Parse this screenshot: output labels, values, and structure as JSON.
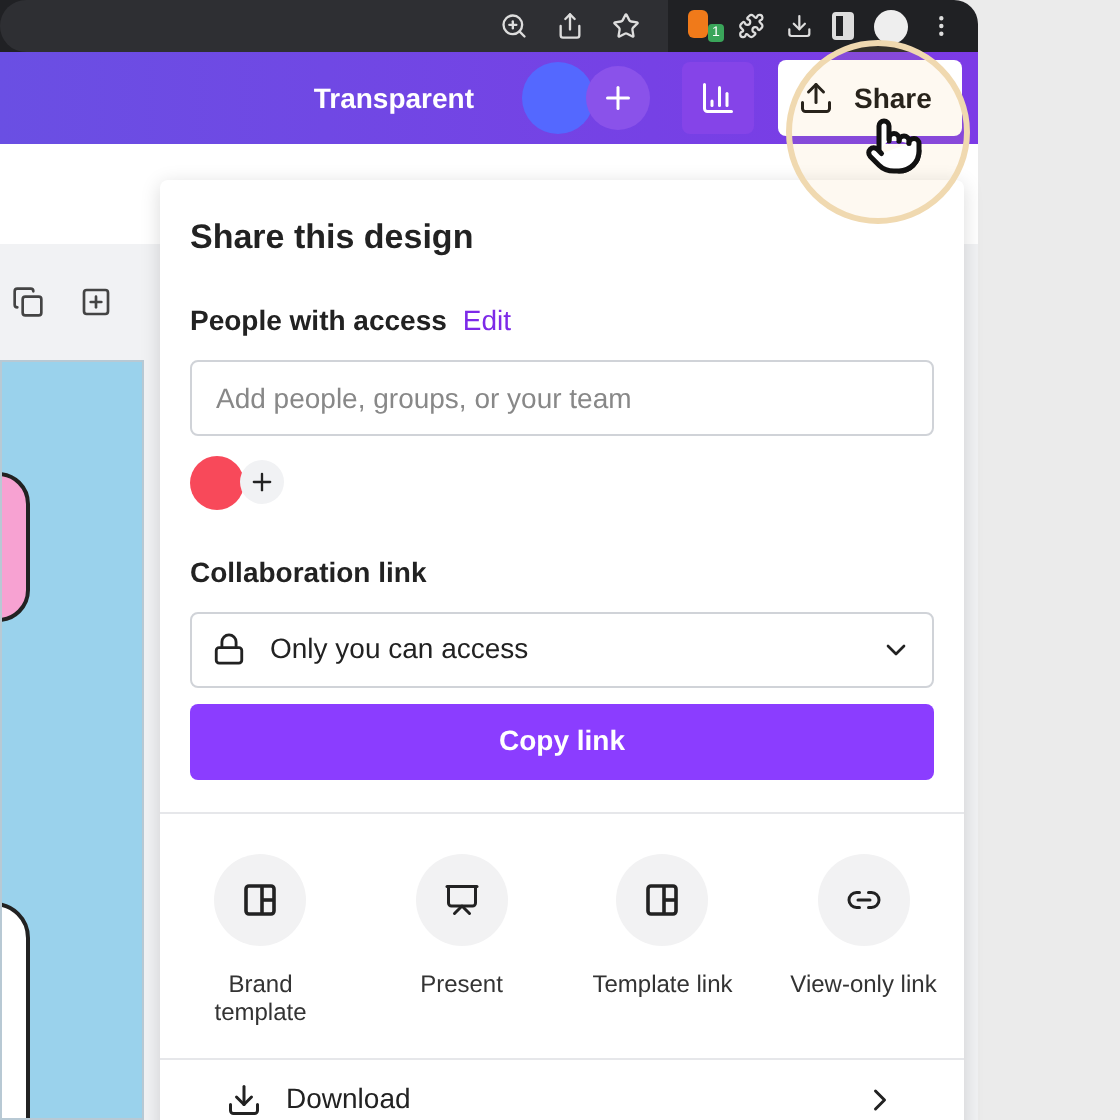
{
  "browser": {
    "extension_badge": "1"
  },
  "toolbar": {
    "title": "Transparent",
    "share_button": "Share"
  },
  "share_panel": {
    "title": "Share this design",
    "people_label": "People with access",
    "edit_link": "Edit",
    "search": {
      "placeholder": "Add people, groups, or your team"
    },
    "collaborators": [
      {
        "color": "#f8495a"
      }
    ],
    "collab_label": "Collaboration link",
    "access_select": "Only you can access",
    "copy_button": "Copy link",
    "options": [
      {
        "kind": "template",
        "label": "Brand template"
      },
      {
        "kind": "present",
        "label": "Present"
      },
      {
        "kind": "template",
        "label": "Template link"
      },
      {
        "kind": "link",
        "label": "View-only link"
      }
    ],
    "download": "Download"
  }
}
